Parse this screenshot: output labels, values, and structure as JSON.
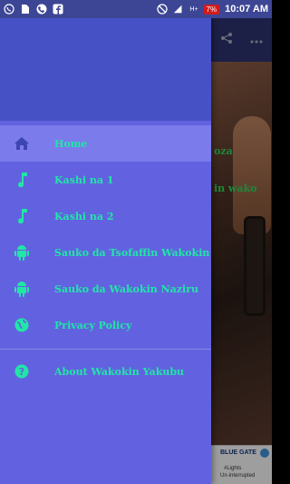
{
  "status_bar": {
    "time": "10:07 AM",
    "battery": "7%",
    "network": "H+"
  },
  "app": {
    "photo_text_1": "oza",
    "photo_text_2": "in wako"
  },
  "ad": {
    "brand": "BLUE GATE",
    "line1": "#Lights",
    "line2": "Un-interrupted"
  },
  "drawer": {
    "items": [
      {
        "label": "Home",
        "icon": "home-icon",
        "active": true
      },
      {
        "label": "Kashi na 1",
        "icon": "music-note-icon",
        "active": false
      },
      {
        "label": "Kashi na 2",
        "icon": "music-note-icon",
        "active": false
      },
      {
        "label": "Sauko da Tsofaffin Wakokin",
        "icon": "android-icon",
        "active": false
      },
      {
        "label": "Sauko da Wakokin Naziru",
        "icon": "android-icon",
        "active": false
      },
      {
        "label": "Privacy Policy",
        "icon": "globe-icon",
        "active": false
      }
    ],
    "footer_item": {
      "label": "About Wakokin Yakubu",
      "icon": "help-icon"
    }
  },
  "colors": {
    "drawer_bg": "#6262e0",
    "drawer_header": "#4651c6",
    "active_item": "#7b7bec",
    "accent_text": "#21e6a6",
    "status_bar": "#3d4695"
  }
}
